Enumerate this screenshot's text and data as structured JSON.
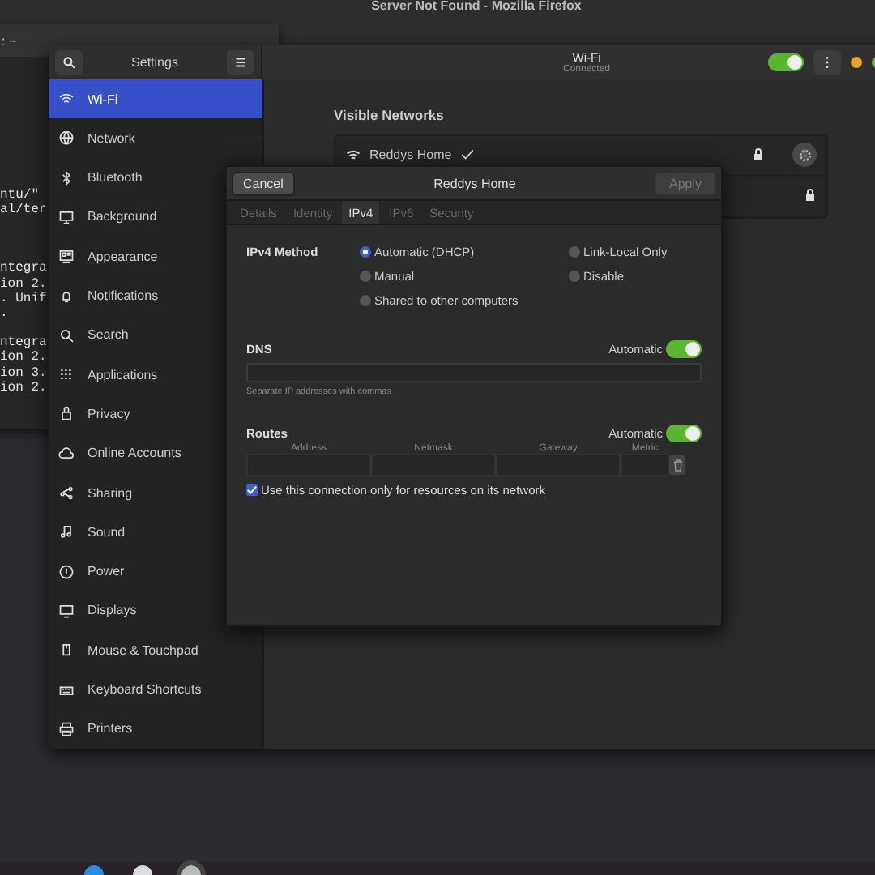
{
  "browser_window": {
    "title": "Server Not Found - Mozilla Firefox"
  },
  "terminal": {
    "title": ": ~",
    "blocks": [
      [
        "ntu/\"",
        "al/ter"
      ],
      [
        "ntegra",
        "ion 2.",
        ". Unif",
        "."
      ],
      [
        "ntegra",
        "ion 2.",
        "ion 3.",
        "ion 2."
      ]
    ]
  },
  "settings": {
    "title": "Settings",
    "sidebar": [
      {
        "label": "Wi-Fi",
        "selected": true
      },
      {
        "label": "Network",
        "selected": false
      },
      {
        "label": "Bluetooth",
        "selected": false
      },
      {
        "label": "Background",
        "selected": false
      },
      {
        "label": "Appearance",
        "selected": false
      },
      {
        "label": "Notifications",
        "selected": false
      },
      {
        "label": "Search",
        "selected": false
      },
      {
        "label": "Applications",
        "selected": false
      },
      {
        "label": "Privacy",
        "selected": false
      },
      {
        "label": "Online Accounts",
        "selected": false
      },
      {
        "label": "Sharing",
        "selected": false
      },
      {
        "label": "Sound",
        "selected": false
      },
      {
        "label": "Power",
        "selected": false
      },
      {
        "label": "Displays",
        "selected": false
      },
      {
        "label": "Mouse & Touchpad",
        "selected": false
      },
      {
        "label": "Keyboard Shortcuts",
        "selected": false
      },
      {
        "label": "Printers",
        "selected": false
      }
    ],
    "panel": {
      "title": "Wi-Fi",
      "subtitle": "Connected",
      "wifi_on": true
    },
    "networks_heading": "Visible Networks",
    "networks": [
      {
        "name": "Reddys Home",
        "connected": true,
        "secured": true
      },
      {
        "secured": true
      }
    ]
  },
  "dialog": {
    "title": "Reddys Home",
    "cancel": "Cancel",
    "apply": "Apply",
    "apply_disabled": true,
    "tabs": [
      {
        "label": "Details",
        "selected": false
      },
      {
        "label": "Identity",
        "selected": false
      },
      {
        "label": "IPv4",
        "selected": true
      },
      {
        "label": "IPv6",
        "selected": false
      },
      {
        "label": "Security",
        "selected": false
      }
    ],
    "method_label": "IPv4 Method",
    "methods": [
      {
        "label": "Automatic (DHCP)",
        "selected": true
      },
      {
        "label": "Link-Local Only",
        "selected": false
      },
      {
        "label": "Manual",
        "selected": false
      },
      {
        "label": "Disable",
        "selected": false
      },
      {
        "label": "Shared to other computers",
        "selected": false
      }
    ],
    "dns": {
      "label": "DNS",
      "automatic_label": "Automatic",
      "automatic": true,
      "hint": "Separate IP addresses with commas"
    },
    "routes": {
      "label": "Routes",
      "automatic_label": "Automatic",
      "automatic": true,
      "columns": [
        "Address",
        "Netmask",
        "Gateway",
        "Metric"
      ]
    },
    "only_local": {
      "label": "Use this connection only for resources on its network",
      "checked": true
    }
  }
}
